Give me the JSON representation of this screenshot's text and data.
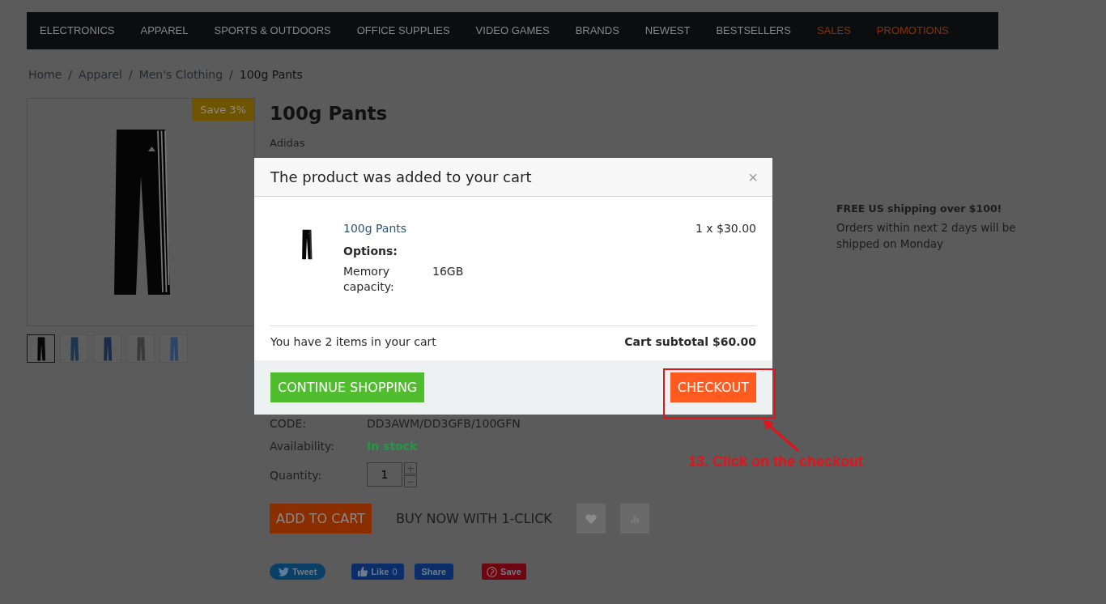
{
  "nav": {
    "items": [
      {
        "label": "ELECTRONICS",
        "kind": "normal"
      },
      {
        "label": "APPAREL",
        "kind": "normal"
      },
      {
        "label": "SPORTS & OUTDOORS",
        "kind": "normal"
      },
      {
        "label": "OFFICE SUPPLIES",
        "kind": "normal"
      },
      {
        "label": "VIDEO GAMES",
        "kind": "normal"
      },
      {
        "label": "BRANDS",
        "kind": "normal"
      },
      {
        "label": "NEWEST",
        "kind": "normal"
      },
      {
        "label": "BESTSELLERS",
        "kind": "normal"
      },
      {
        "label": "SALES",
        "kind": "promo"
      },
      {
        "label": "PROMOTIONS",
        "kind": "promo"
      }
    ]
  },
  "breadcrumb": [
    {
      "label": "Home"
    },
    {
      "label": "Apparel"
    },
    {
      "label": "Men's Clothing"
    },
    {
      "label": "100g Pants"
    }
  ],
  "breadcrumb_separator": "/",
  "product": {
    "badge": "Save 3%",
    "thumbnails": [
      {
        "selected": true
      },
      {
        "selected": false
      },
      {
        "selected": false
      },
      {
        "selected": false
      },
      {
        "selected": false
      }
    ],
    "title": "100g Pants",
    "brand": "Adidas",
    "details": [
      {
        "label": "CODE:",
        "value": "DD3AWM/DD3GFB/100GFN",
        "kind": "plain"
      },
      {
        "label": "Availability:",
        "value": "In stock",
        "kind": "stock"
      }
    ],
    "quantity": {
      "label": "Quantity:",
      "value": "1",
      "plus": "+",
      "minus": "−"
    },
    "add_to_cart": "ADD TO CART",
    "buy_now": "BUY NOW WITH 1-CLICK",
    "share": [
      {
        "label": "Tweet",
        "kind": "twitter"
      },
      {
        "label": "Like",
        "count": "0",
        "kind": "like"
      },
      {
        "label": "Share",
        "kind": "share"
      },
      {
        "label": "Save",
        "kind": "pinterest"
      }
    ]
  },
  "shipping": {
    "title": "FREE US shipping over $100!",
    "text": "Orders within next 2 days will be shipped on Monday"
  },
  "modal": {
    "title": "The product was added to your cart",
    "close": "×",
    "item": {
      "name": "100g Pants",
      "price": "1 x $30.00",
      "options_label": "Options:",
      "options": [
        {
          "name": "Memory capacity:",
          "value": "16GB"
        }
      ]
    },
    "count_text": "You have 2 items in your cart",
    "subtotal": "Cart subtotal $60.00",
    "continue": "CONTINUE SHOPPING",
    "checkout": "CHECKOUT"
  },
  "annotation": {
    "text": "13. Click on the checkout"
  }
}
